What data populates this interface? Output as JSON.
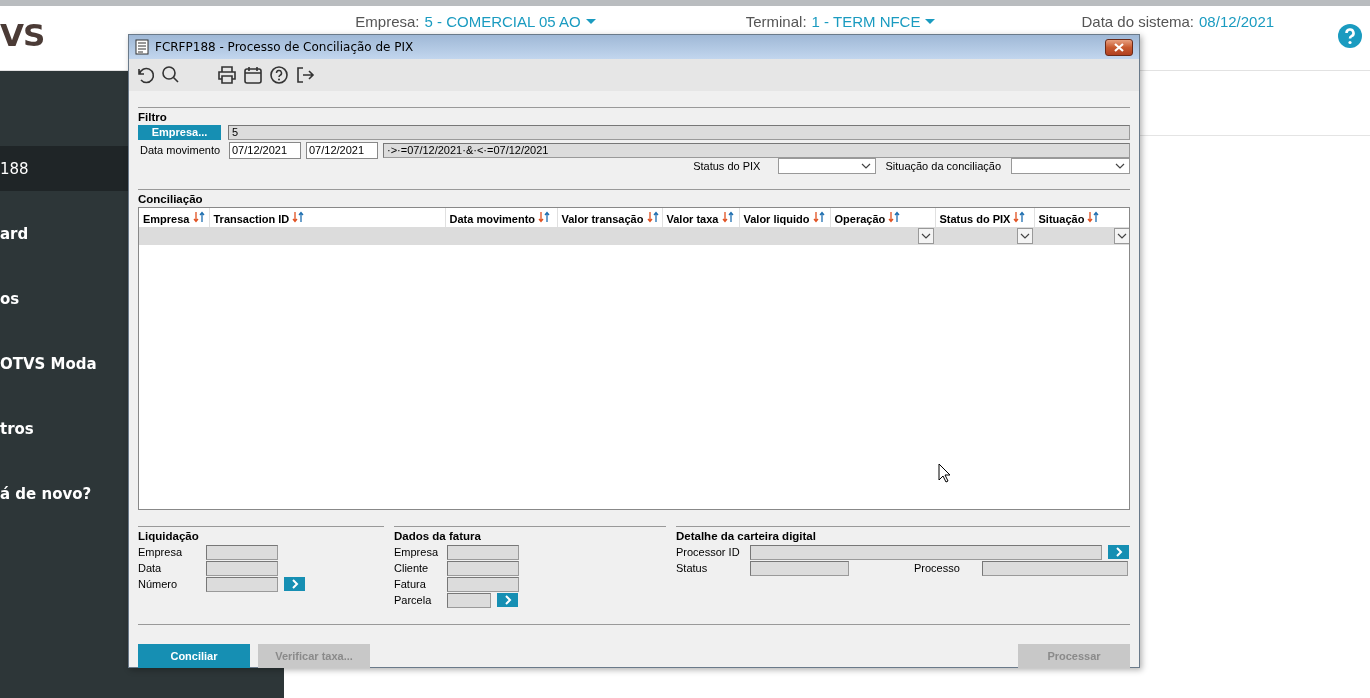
{
  "header": {
    "logo": "VS",
    "fields": [
      {
        "label": "Empresa:",
        "value": "5 - COMERCIAL 05 AO",
        "dropdown": true
      },
      {
        "label": "Terminal:",
        "value": "1 - TERM NFCE",
        "dropdown": true
      },
      {
        "label": "Data do sistema:",
        "value": "08/12/2021",
        "dropdown": false
      }
    ]
  },
  "sidebar": {
    "items": [
      {
        "label": "188",
        "selected": true
      },
      {
        "label": "ard",
        "selected": false
      },
      {
        "label": "os",
        "selected": false
      },
      {
        "label": "OTVS Moda",
        "selected": false
      },
      {
        "label": "tros",
        "selected": false
      },
      {
        "label": "á de novo?",
        "selected": false
      }
    ]
  },
  "dialog": {
    "title": "FCRFP188 - Processo de Conciliação de PIX",
    "toolbar": [
      {
        "kind": "undo"
      },
      {
        "kind": "search"
      },
      {
        "kind": "print"
      },
      {
        "kind": "calendar"
      },
      {
        "kind": "help"
      },
      {
        "kind": "exit"
      }
    ],
    "filter": {
      "title": "Filtro",
      "empresa_button": "Empresa...",
      "empresa_value": "5",
      "date_label": "Data movimento",
      "date_from": "07/12/2021",
      "date_to": "07/12/2021",
      "expression": "·>·=07/12/2021·&·<·=07/12/2021",
      "status_pix_label": "Status do PIX",
      "situacao_label": "Situação da conciliação"
    },
    "grid": {
      "title": "Conciliação",
      "columns": [
        {
          "label": "Empresa",
          "filter": false
        },
        {
          "label": "Transaction ID",
          "filter": false
        },
        {
          "label": "Data movimento",
          "filter": false
        },
        {
          "label": "Valor transação",
          "filter": false
        },
        {
          "label": "Valor taxa",
          "filter": false
        },
        {
          "label": "Valor liquido",
          "filter": false
        },
        {
          "label": "Operação",
          "filter": true
        },
        {
          "label": "Status do PIX",
          "filter": true
        },
        {
          "label": "Situação",
          "filter": true
        }
      ]
    },
    "liquidacao": {
      "title": "Liquidação",
      "fields": [
        "Empresa",
        "Data",
        "Número"
      ]
    },
    "fatura": {
      "title": "Dados da fatura",
      "fields": [
        "Empresa",
        "Cliente",
        "Fatura",
        "Parcela"
      ]
    },
    "carteira": {
      "title": "Detalhe da carteira digital",
      "processor_label": "Processor ID",
      "status_label": "Status",
      "processo_label": "Processo"
    },
    "buttons": [
      {
        "label": "Conciliar",
        "disabled": false
      },
      {
        "label": "Verificar taxa...",
        "disabled": true
      },
      {
        "label": "Processar",
        "disabled": true
      }
    ]
  }
}
